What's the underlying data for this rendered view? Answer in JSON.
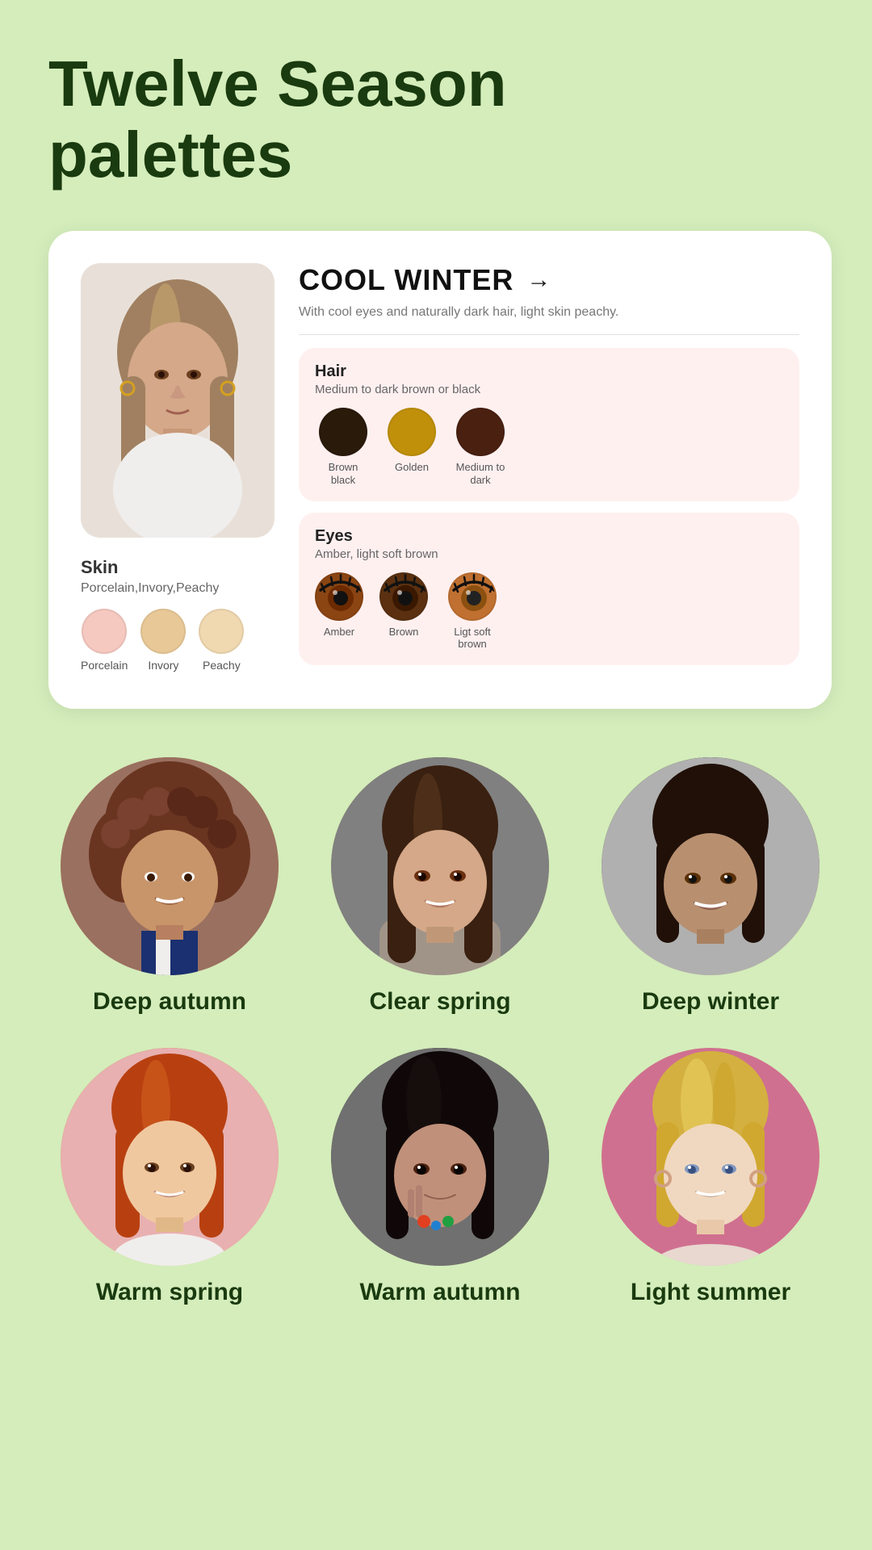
{
  "page": {
    "title_line1": "Twelve Season",
    "title_line2": "palettes",
    "background_color": "#d4edbb"
  },
  "card": {
    "season_name": "COOL WINTER",
    "season_description": "With cool eyes and naturally dark hair, light skin peachy.",
    "arrow": "→",
    "skin": {
      "label": "Skin",
      "sub_label": "Porcelain,Invory,Peachy",
      "swatches": [
        {
          "label": "Porcelain",
          "color": "#f5c8c0"
        },
        {
          "label": "Invory",
          "color": "#e8c896"
        },
        {
          "label": "Peachy",
          "color": "#f0d8b0"
        }
      ]
    },
    "hair": {
      "label": "Hair",
      "sub_label": "Medium to dark brown or black",
      "swatches": [
        {
          "label": "Brown black",
          "color": "#2a1a0a"
        },
        {
          "label": "Golden",
          "color": "#c0900a"
        },
        {
          "label": "Medium to dark",
          "color": "#4a2010"
        }
      ]
    },
    "eyes": {
      "label": "Eyes",
      "sub_label": "Amber, light soft brown",
      "swatches": [
        {
          "label": "Amber",
          "color": "#8b4513",
          "iris": "#6b2a00"
        },
        {
          "label": "Brown",
          "color": "#5a3010",
          "iris": "#3a1800"
        },
        {
          "label": "Ligt soft brown",
          "color": "#c07030",
          "iris": "#8b5010"
        }
      ]
    }
  },
  "people": {
    "row1": [
      {
        "name": "Deep autumn",
        "bg_class": "deep-autumn-bg"
      },
      {
        "name": "Clear spring",
        "bg_class": "clear-spring-bg"
      },
      {
        "name": "Deep winter",
        "bg_class": "deep-winter-bg"
      }
    ],
    "row2": [
      {
        "name": "Warm spring",
        "bg_class": "warm-spring-bg"
      },
      {
        "name": "Warm autumn",
        "bg_class": "warm-autumn-bg"
      },
      {
        "name": "Light summer",
        "bg_class": "light-summer-bg"
      }
    ]
  }
}
